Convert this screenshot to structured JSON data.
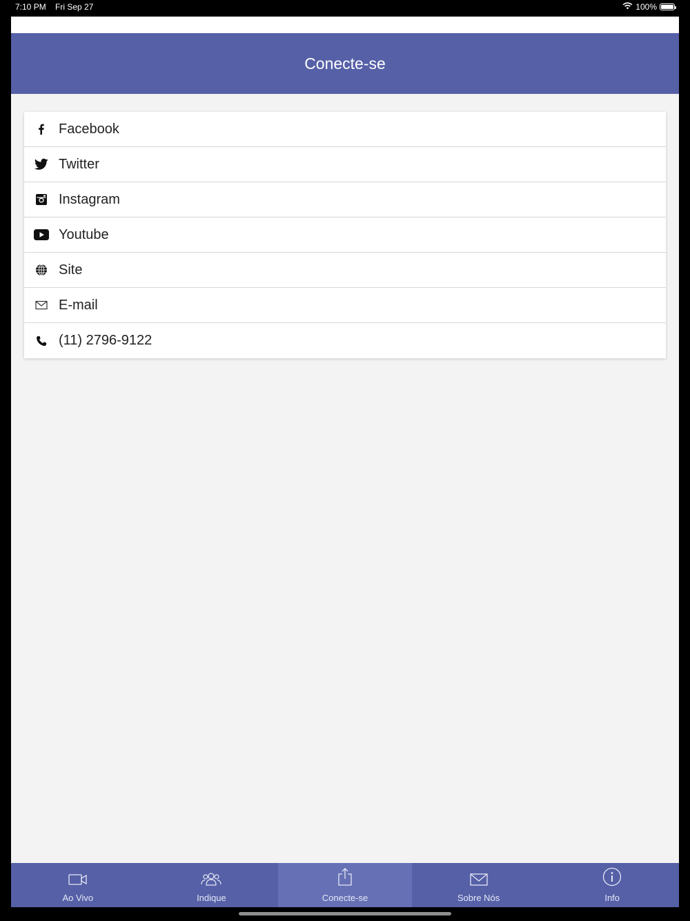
{
  "status_bar": {
    "time": "7:10 PM",
    "date": "Fri Sep 27",
    "battery": "100%"
  },
  "header": {
    "title": "Conecte-se"
  },
  "links": [
    {
      "icon": "facebook-icon",
      "label": "Facebook"
    },
    {
      "icon": "twitter-icon",
      "label": "Twitter"
    },
    {
      "icon": "instagram-icon",
      "label": "Instagram"
    },
    {
      "icon": "youtube-icon",
      "label": "Youtube"
    },
    {
      "icon": "globe-icon",
      "label": "Site"
    },
    {
      "icon": "mail-icon",
      "label": "E-mail"
    },
    {
      "icon": "phone-icon",
      "label": "(11) 2796-9122"
    }
  ],
  "tabs": [
    {
      "icon": "video-camera-icon",
      "label": "Ao Vivo"
    },
    {
      "icon": "people-icon",
      "label": "Indique"
    },
    {
      "icon": "share-icon",
      "label": "Conecte-se",
      "active": true
    },
    {
      "icon": "envelope-icon",
      "label": "Sobre Nós"
    },
    {
      "icon": "info-icon",
      "label": "Info"
    }
  ],
  "colors": {
    "header": "#5560a7",
    "tabbar": "#5560a7",
    "tab_active": "#6670b5",
    "background": "#f3f3f3"
  }
}
